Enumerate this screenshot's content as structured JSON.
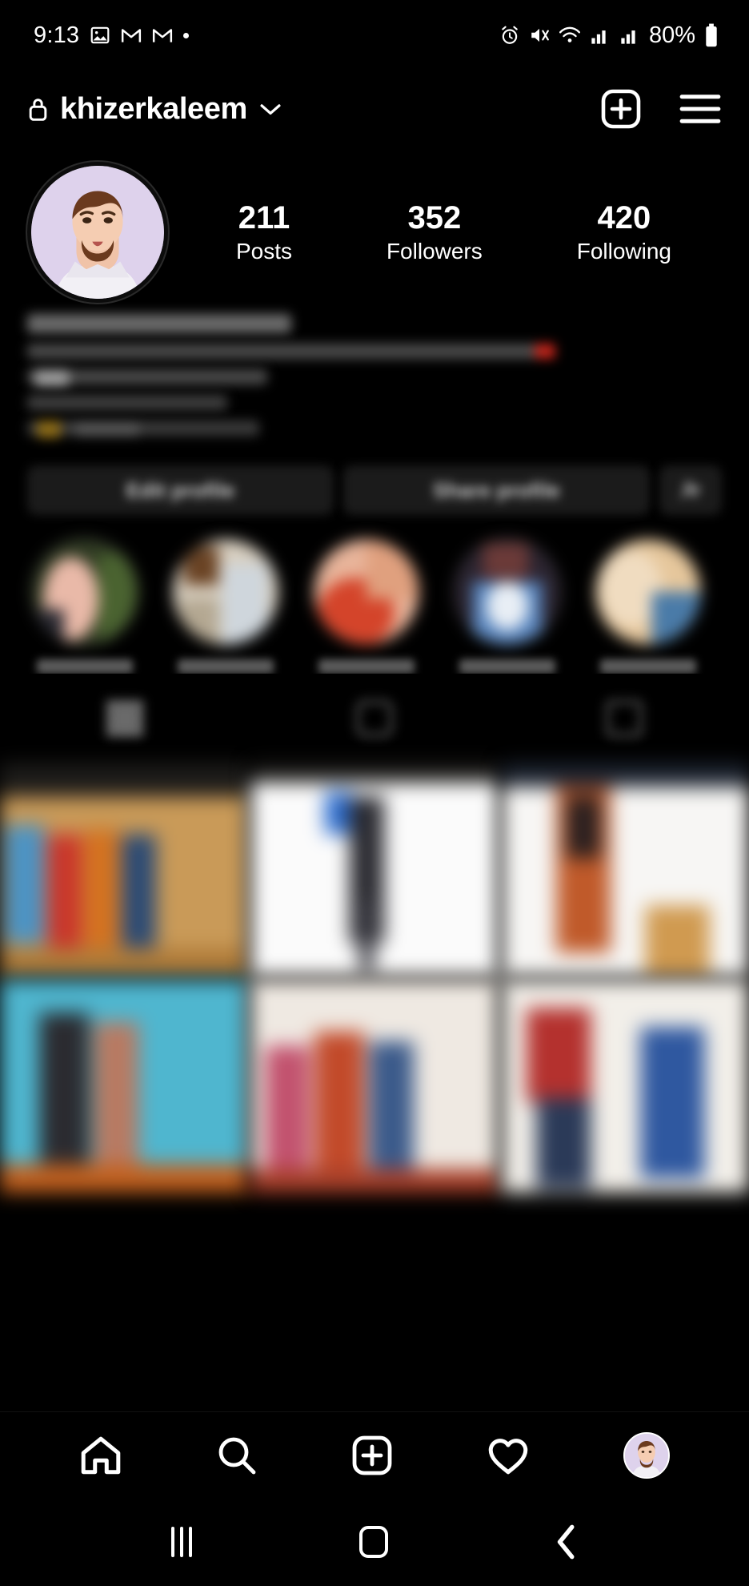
{
  "status_bar": {
    "time": "9:13",
    "battery_percent": "80%",
    "left_icons": [
      "image-icon",
      "gmail-icon",
      "gmail-icon",
      "dot-icon"
    ],
    "right_icons": [
      "alarm-icon",
      "mute-icon",
      "wifi-icon",
      "signal-icon",
      "signal-icon",
      "battery-icon"
    ]
  },
  "profile_header": {
    "privacy_icon": "lock-icon",
    "username": "khizerkaleem",
    "chevron_icon": "chevron-down-icon",
    "create_icon": "plus-box-icon",
    "menu_icon": "hamburger-menu-icon"
  },
  "profile": {
    "avatar_name": "profile-avatar",
    "stats": [
      {
        "value": "211",
        "label": "Posts"
      },
      {
        "value": "352",
        "label": "Followers"
      },
      {
        "value": "420",
        "label": "Following"
      }
    ],
    "bio_blurred": true,
    "buttons": [
      {
        "label": "Edit profile",
        "name": "edit-profile-button"
      },
      {
        "label": "Share profile",
        "name": "share-profile-button"
      },
      {
        "label": "",
        "name": "discover-people-button"
      }
    ]
  },
  "highlights": [
    {
      "name": "story-highlight-1",
      "label_blurred": true
    },
    {
      "name": "story-highlight-2",
      "label_blurred": true
    },
    {
      "name": "story-highlight-3",
      "label_blurred": true
    },
    {
      "name": "story-highlight-4",
      "label_blurred": true
    },
    {
      "name": "story-highlight-5",
      "label_blurred": true
    }
  ],
  "tabs": [
    {
      "name": "tab-grid",
      "icon": "grid-icon"
    },
    {
      "name": "tab-reels",
      "icon": "reels-icon"
    },
    {
      "name": "tab-tagged",
      "icon": "tagged-icon"
    }
  ],
  "post_grid": {
    "rows": 2,
    "columns": 3,
    "cells": [
      {
        "name": "post-thumbnail-1"
      },
      {
        "name": "post-thumbnail-2"
      },
      {
        "name": "post-thumbnail-3"
      },
      {
        "name": "post-thumbnail-4"
      },
      {
        "name": "post-thumbnail-5"
      },
      {
        "name": "post-thumbnail-6"
      }
    ]
  },
  "bottom_nav": [
    {
      "name": "nav-home",
      "icon": "home-icon"
    },
    {
      "name": "nav-search",
      "icon": "search-icon"
    },
    {
      "name": "nav-create",
      "icon": "plus-box-icon"
    },
    {
      "name": "nav-activity",
      "icon": "heart-icon"
    },
    {
      "name": "nav-profile",
      "icon": "avatar-icon"
    }
  ],
  "system_nav": [
    {
      "name": "sysnav-recents",
      "icon": "recents-icon"
    },
    {
      "name": "sysnav-home",
      "icon": "home-square-icon"
    },
    {
      "name": "sysnav-back",
      "icon": "back-chevron-icon"
    }
  ],
  "colors": {
    "background": "#000000",
    "text": "#ffffff",
    "surface": "#1b1b1b",
    "avatar_bg": "#ded2ec"
  }
}
